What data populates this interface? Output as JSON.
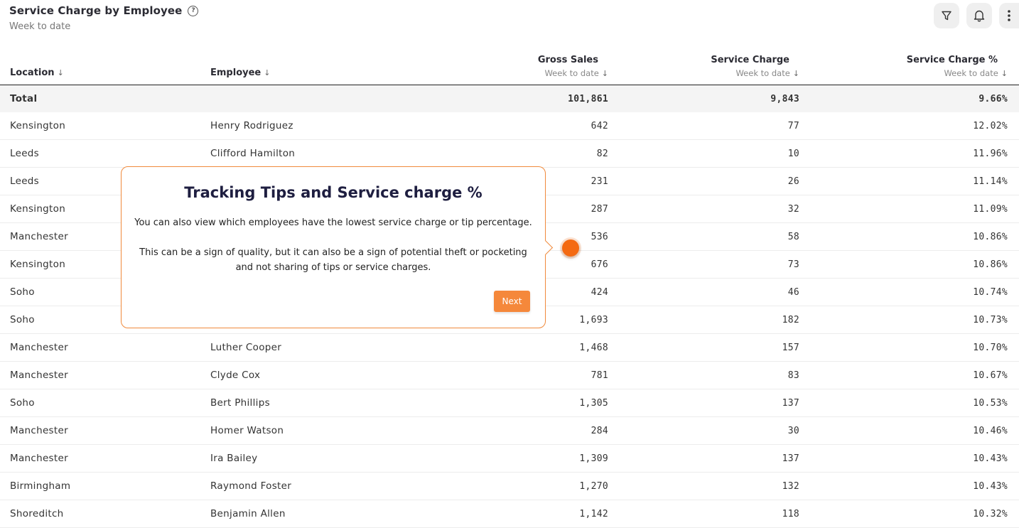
{
  "header": {
    "title": "Service Charge by Employee",
    "help_icon": "question-circle-icon",
    "subtitle": "Week to date"
  },
  "toolbar": {
    "filter_icon": "filter-icon",
    "bell_icon": "bell-icon",
    "more_icon": "more-vertical-icon"
  },
  "table": {
    "columns": {
      "location": "Location",
      "employee": "Employee",
      "gross_sales": "Gross Sales",
      "gross_sales_sub": "Week to date",
      "service_charge": "Service Charge",
      "service_charge_sub": "Week to date",
      "service_charge_pct": "Service Charge %",
      "service_charge_pct_sub": "Week to date",
      "sort_arrow": "↓"
    },
    "total": {
      "label": "Total",
      "gross_sales": "101,861",
      "service_charge": "9,843",
      "service_charge_pct": "9.66%"
    },
    "rows": [
      {
        "location": "Kensington",
        "employee": "Henry Rodriguez",
        "gross": "642",
        "sc": "77",
        "pct": "12.02%"
      },
      {
        "location": "Leeds",
        "employee": "Clifford Hamilton",
        "gross": "82",
        "sc": "10",
        "pct": "11.96%"
      },
      {
        "location": "Leeds",
        "employee": "",
        "gross": "231",
        "sc": "26",
        "pct": "11.14%"
      },
      {
        "location": "Kensington",
        "employee": "",
        "gross": "287",
        "sc": "32",
        "pct": "11.09%"
      },
      {
        "location": "Manchester",
        "employee": "",
        "gross": "536",
        "sc": "58",
        "pct": "10.86%"
      },
      {
        "location": "Kensington",
        "employee": "",
        "gross": "676",
        "sc": "73",
        "pct": "10.86%"
      },
      {
        "location": "Soho",
        "employee": "",
        "gross": "424",
        "sc": "46",
        "pct": "10.74%"
      },
      {
        "location": "Soho",
        "employee": "",
        "gross": "1,693",
        "sc": "182",
        "pct": "10.73%"
      },
      {
        "location": "Manchester",
        "employee": "Luther Cooper",
        "gross": "1,468",
        "sc": "157",
        "pct": "10.70%"
      },
      {
        "location": "Manchester",
        "employee": "Clyde Cox",
        "gross": "781",
        "sc": "83",
        "pct": "10.67%"
      },
      {
        "location": "Soho",
        "employee": "Bert Phillips",
        "gross": "1,305",
        "sc": "137",
        "pct": "10.53%"
      },
      {
        "location": "Manchester",
        "employee": "Homer Watson",
        "gross": "284",
        "sc": "30",
        "pct": "10.46%"
      },
      {
        "location": "Manchester",
        "employee": "Ira Bailey",
        "gross": "1,309",
        "sc": "137",
        "pct": "10.43%"
      },
      {
        "location": "Birmingham",
        "employee": "Raymond Foster",
        "gross": "1,270",
        "sc": "132",
        "pct": "10.43%"
      },
      {
        "location": "Shoreditch",
        "employee": "Benjamin Allen",
        "gross": "1,142",
        "sc": "118",
        "pct": "10.32%"
      }
    ]
  },
  "tour": {
    "title": "Tracking Tips and Service charge %",
    "paragraph1": "You can also view which employees have the lowest service charge or tip percentage.",
    "paragraph2": "This can be a sign of quality, but it can also be a sign of potential theft or pocketing and not sharing of tips or service charges.",
    "next_label": "Next",
    "accent_color": "#f5883b"
  }
}
